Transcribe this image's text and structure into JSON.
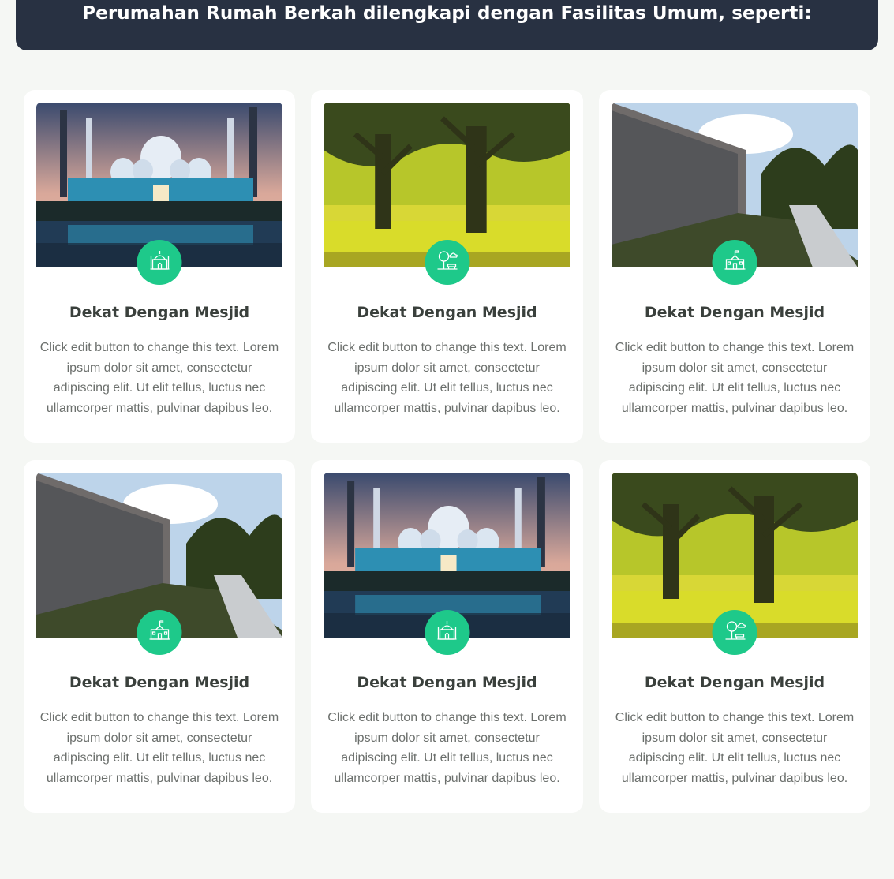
{
  "header": {
    "title": "Perumahan Rumah Berkah dilengkapi dengan Fasilitas Umum, seperti:"
  },
  "colors": {
    "banner": "#283142",
    "accent": "#1ec98a",
    "background": "#f5f7f4"
  },
  "cards": [
    {
      "title": "Dekat Dengan Mesjid",
      "text": "Click edit button to change this text. Lorem ipsum dolor sit amet, consectetur adipiscing elit. Ut elit tellus, luctus nec ullamcorper mattis, pulvinar dapibus leo.",
      "image": "mosque",
      "icon": "mosque-icon"
    },
    {
      "title": "Dekat Dengan Mesjid",
      "text": "Click edit button to change this text. Lorem ipsum dolor sit amet, consectetur adipiscing elit. Ut elit tellus, luctus nec ullamcorper mattis, pulvinar dapibus leo.",
      "image": "park",
      "icon": "park-icon"
    },
    {
      "title": "Dekat Dengan Mesjid",
      "text": "Click edit button to change this text. Lorem ipsum dolor sit amet, consectetur adipiscing elit. Ut elit tellus, luctus nec ullamcorper mattis, pulvinar dapibus leo.",
      "image": "school",
      "icon": "school-icon"
    },
    {
      "title": "Dekat Dengan Mesjid",
      "text": "Click edit button to change this text. Lorem ipsum dolor sit amet, consectetur adipiscing elit. Ut elit tellus, luctus nec ullamcorper mattis, pulvinar dapibus leo.",
      "image": "school",
      "icon": "school-icon"
    },
    {
      "title": "Dekat Dengan Mesjid",
      "text": "Click edit button to change this text. Lorem ipsum dolor sit amet, consectetur adipiscing elit. Ut elit tellus, luctus nec ullamcorper mattis, pulvinar dapibus leo.",
      "image": "mosque",
      "icon": "mosque-icon"
    },
    {
      "title": "Dekat Dengan Mesjid",
      "text": "Click edit button to change this text. Lorem ipsum dolor sit amet, consectetur adipiscing elit. Ut elit tellus, luctus nec ullamcorper mattis, pulvinar dapibus leo.",
      "image": "park",
      "icon": "park-icon"
    }
  ]
}
